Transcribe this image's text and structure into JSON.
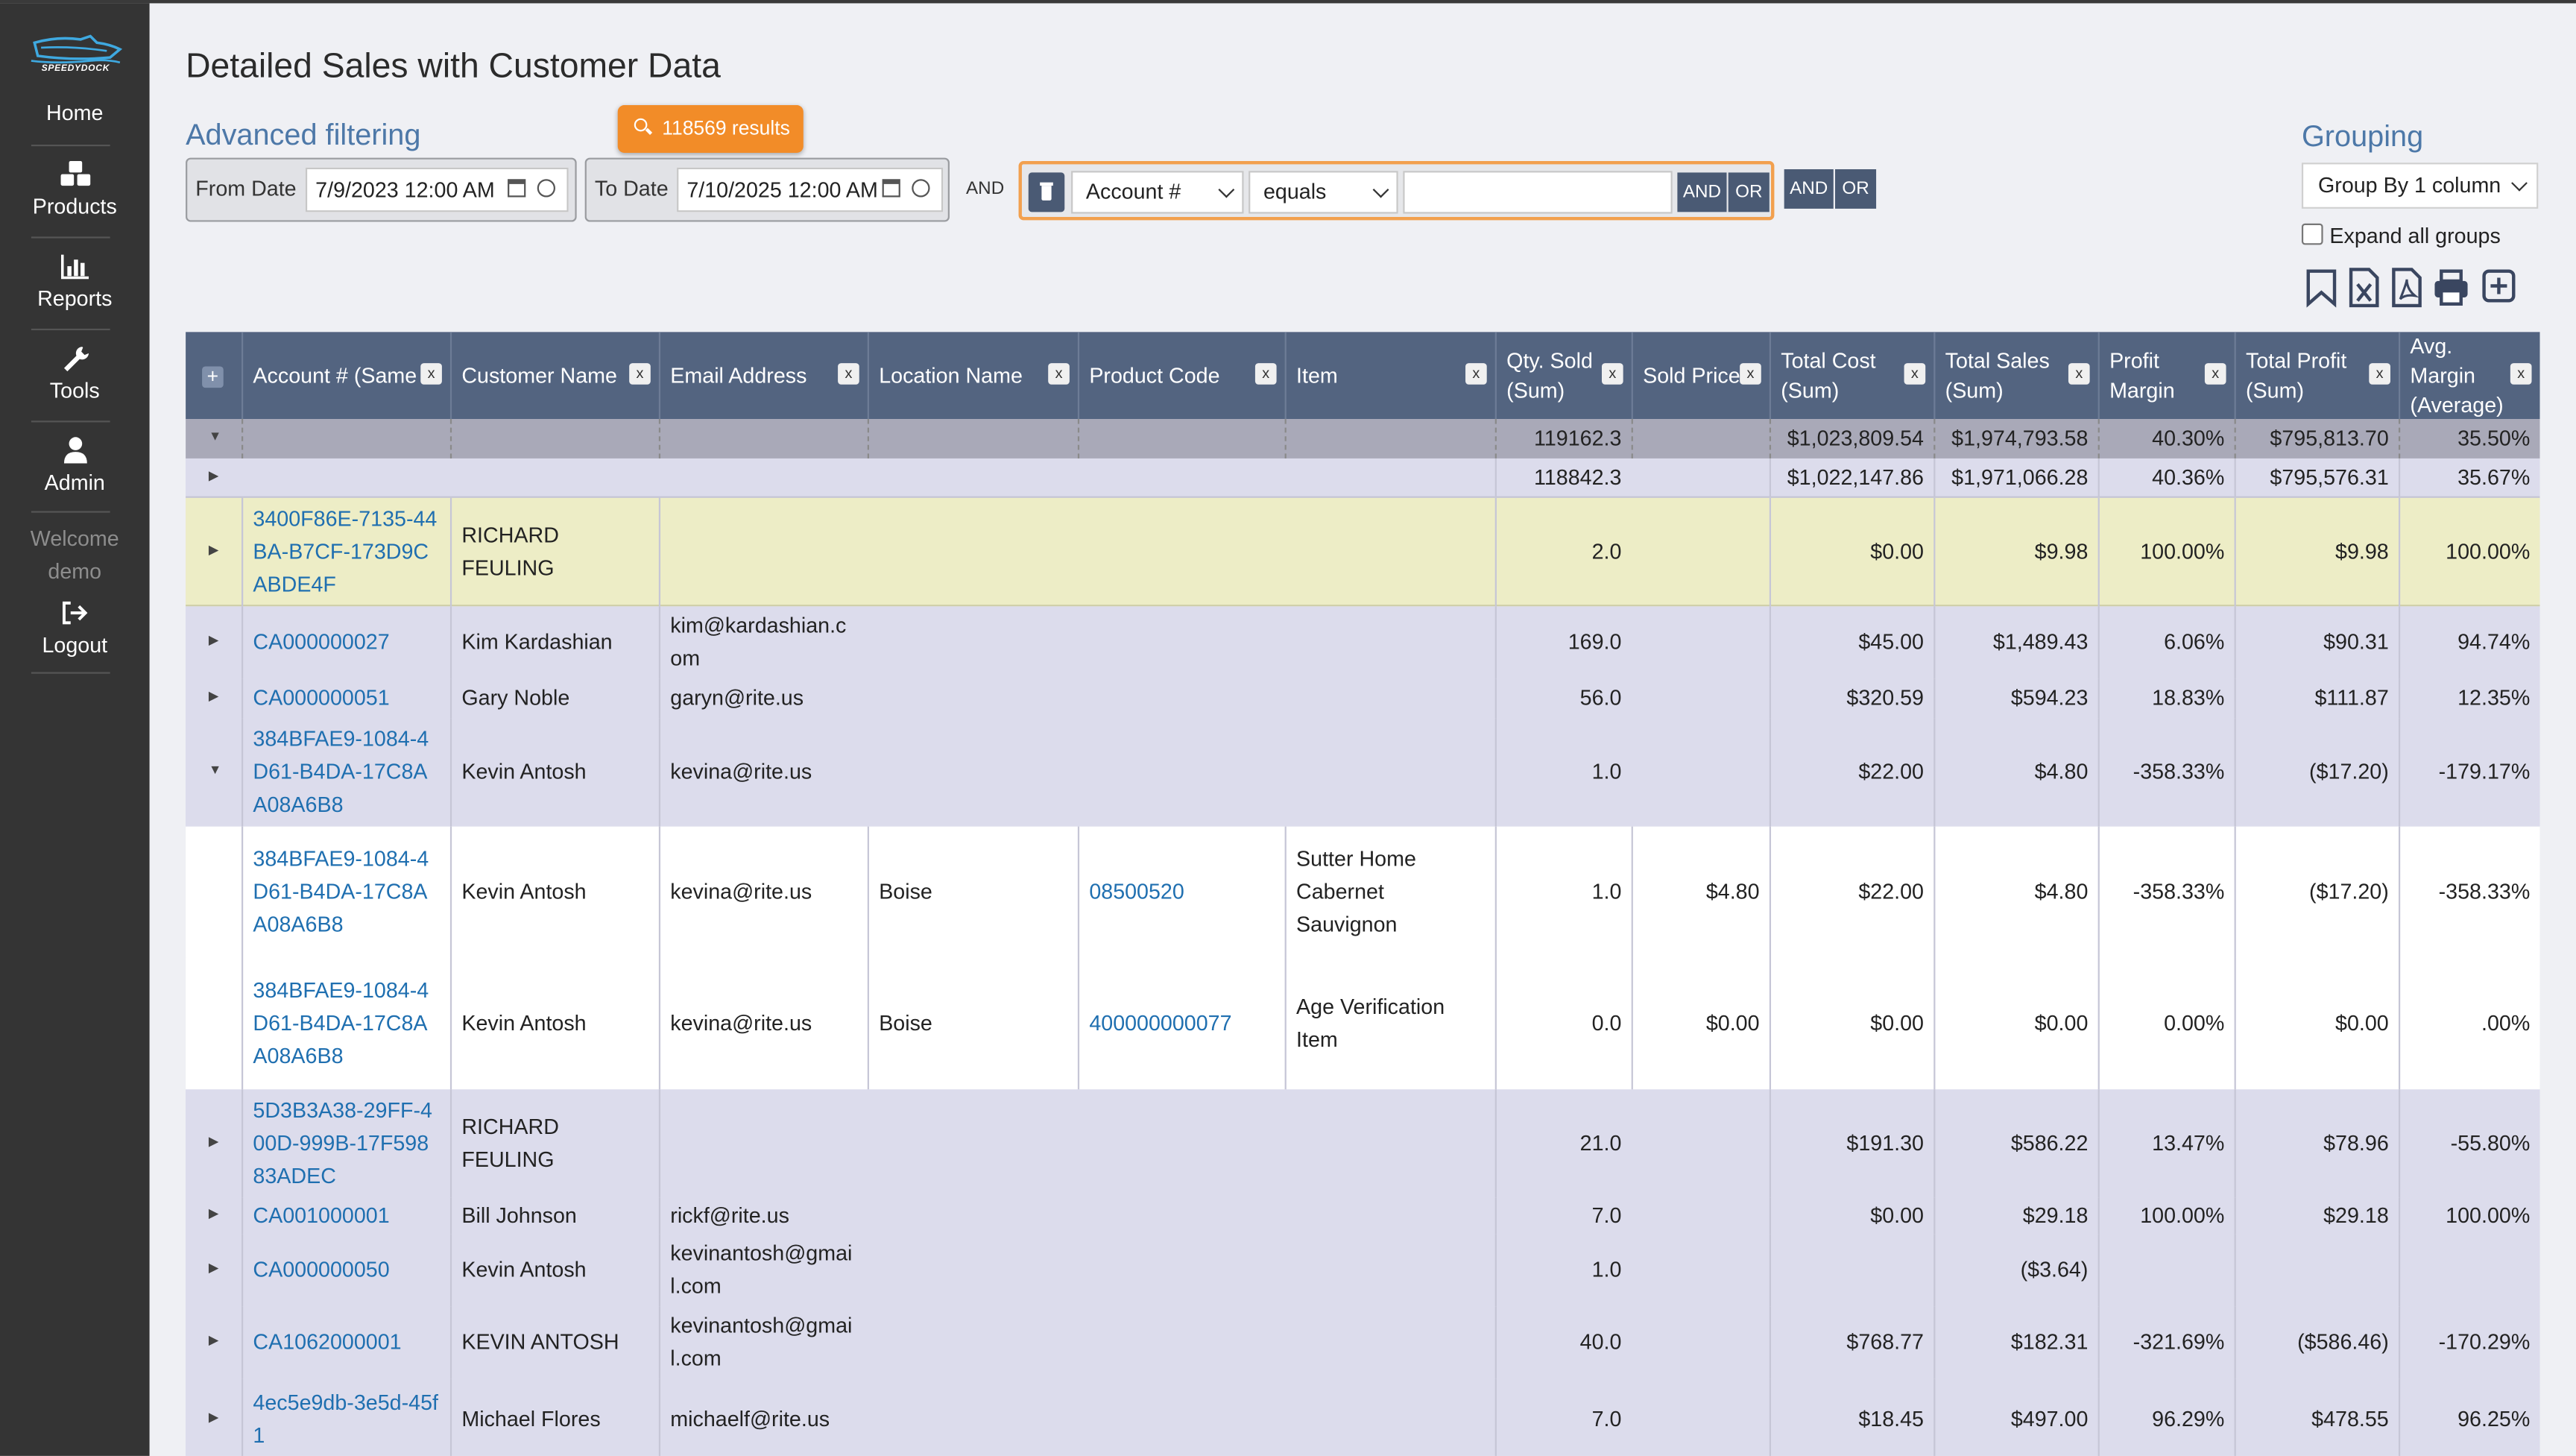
{
  "sidebar": {
    "logo_text": "SPEEDYDOCK",
    "items": [
      {
        "label": "Home",
        "icon": "home"
      },
      {
        "label": "Products",
        "icon": "cubes-icon"
      },
      {
        "label": "Reports",
        "icon": "bar-chart-icon"
      },
      {
        "label": "Tools",
        "icon": "wrench-icon"
      },
      {
        "label": "Admin",
        "icon": "user-icon"
      }
    ],
    "welcome": "Welcome",
    "username": "demo",
    "logout": {
      "label": "Logout",
      "icon": "sign-out-icon"
    }
  },
  "page": {
    "title": "Detailed Sales with Customer Data",
    "advanced_filtering": "Advanced filtering",
    "results_badge": "118569 results"
  },
  "filters": {
    "from_label": "From Date",
    "from_value": "7/9/2023 12:00 AM",
    "to_label": "To Date",
    "to_value": "7/10/2025 12:00 AM",
    "and_label": "AND",
    "field_value": "Account #",
    "operator_value": "equals",
    "text_value": "",
    "and_btn": "AND",
    "or_btn": "OR"
  },
  "grouping": {
    "title": "Grouping",
    "value": "Group By 1 column",
    "expand_label": "Expand all groups",
    "tools": [
      "bookmark-icon",
      "excel-icon",
      "pdf-icon",
      "print-icon",
      "add-icon"
    ]
  },
  "table": {
    "plus": "+",
    "remove": "x",
    "headers": [
      "Account # (Same",
      "Customer Name",
      "Email Address",
      "Location Name",
      "Product Code",
      "Item",
      "Qty. Sold (Sum)",
      "Sold Price",
      "Total Cost (Sum)",
      "Total Sales (Sum)",
      "Profit Margin",
      "Total Profit (Sum)",
      "Avg. Margin (Average)"
    ],
    "grand_total": {
      "qty": "119162.3",
      "cost": "$1,023,809.54",
      "sales": "$1,974,793.58",
      "margin": "40.30%",
      "profit": "$795,813.70",
      "avg": "35.50%"
    },
    "subtotal": {
      "qty": "118842.3",
      "cost": "$1,022,147.86",
      "sales": "$1,971,066.28",
      "margin": "40.36%",
      "profit": "$795,576.31",
      "avg": "35.67%"
    },
    "groups": [
      {
        "account": "3400F86E-7135-44BA-B7CF-173D9CABDE4F",
        "name": "RICHARD FEULING",
        "email": "",
        "qty": "2.0",
        "cost": "$0.00",
        "sales": "$9.98",
        "margin": "100.00%",
        "profit": "$9.98",
        "avg": "100.00%"
      },
      {
        "account": "CA000000027",
        "name": "Kim Kardashian",
        "email": "kim@kardashian.com",
        "qty": "169.0",
        "cost": "$45.00",
        "sales": "$1,489.43",
        "margin": "6.06%",
        "profit": "$90.31",
        "avg": "94.74%"
      },
      {
        "account": "CA000000051",
        "name": "Gary Noble",
        "email": "garyn@rite.us",
        "qty": "56.0",
        "cost": "$320.59",
        "sales": "$594.23",
        "margin": "18.83%",
        "profit": "$111.87",
        "avg": "12.35%"
      },
      {
        "account": "384BFAE9-1084-4D61-B4DA-17C8AA08A6B8",
        "name": "Kevin Antosh",
        "email": "kevina@rite.us",
        "qty": "1.0",
        "cost": "$22.00",
        "sales": "$4.80",
        "margin": "-358.33%",
        "profit": "($17.20)",
        "avg": "-179.17%"
      },
      {
        "account": "5D3B3A38-29FF-400D-999B-17F59883ADEC",
        "name": "RICHARD FEULING",
        "email": "",
        "qty": "21.0",
        "cost": "$191.30",
        "sales": "$586.22",
        "margin": "13.47%",
        "profit": "$78.96",
        "avg": "-55.80%"
      },
      {
        "account": "CA001000001",
        "name": "Bill Johnson",
        "email": "rickf@rite.us",
        "qty": "7.0",
        "cost": "$0.00",
        "sales": "$29.18",
        "margin": "100.00%",
        "profit": "$29.18",
        "avg": "100.00%"
      },
      {
        "account": "CA000000050",
        "name": "Kevin Antosh",
        "email": "kevinantosh@gmail.com",
        "qty": "1.0",
        "cost": "",
        "sales": "($3.64)",
        "margin": "",
        "profit": "",
        "avg": ""
      },
      {
        "account": "CA1062000001",
        "name": "KEVIN ANTOSH",
        "email": "kevinantosh@gmail.com",
        "qty": "40.0",
        "cost": "$768.77",
        "sales": "$182.31",
        "margin": "-321.69%",
        "profit": "($586.46)",
        "avg": "-170.29%"
      },
      {
        "account": "4ec5e9db-3e5d-45f1",
        "name": "Michael Flores",
        "email": "michaelf@rite.us",
        "qty": "7.0",
        "cost": "$18.45",
        "sales": "$497.00",
        "margin": "96.29%",
        "profit": "$478.55",
        "avg": "96.25%"
      }
    ],
    "details": [
      {
        "account": "384BFAE9-1084-4D61-B4DA-17C8AA08A6B8",
        "name": "Kevin Antosh",
        "email": "kevina@rite.us",
        "location": "Boise",
        "code": "08500520",
        "item": "Sutter Home Cabernet Sauvignon",
        "qty": "1.0",
        "price": "$4.80",
        "cost": "$22.00",
        "sales": "$4.80",
        "margin": "-358.33%",
        "profit": "($17.20)",
        "avg": "-358.33%"
      },
      {
        "account": "384BFAE9-1084-4D61-B4DA-17C8AA08A6B8",
        "name": "Kevin Antosh",
        "email": "kevina@rite.us",
        "location": "Boise",
        "code": "400000000077",
        "item": "Age Verification Item",
        "qty": "0.0",
        "price": "$0.00",
        "cost": "$0.00",
        "sales": "$0.00",
        "margin": "0.00%",
        "profit": "$0.00",
        "avg": ".00%"
      }
    ]
  },
  "colors": {
    "sidebar": "#343434",
    "header": "#536480",
    "accent": "#f28c28",
    "link": "#1f6fb0",
    "highlight_row": "#ededc6"
  }
}
